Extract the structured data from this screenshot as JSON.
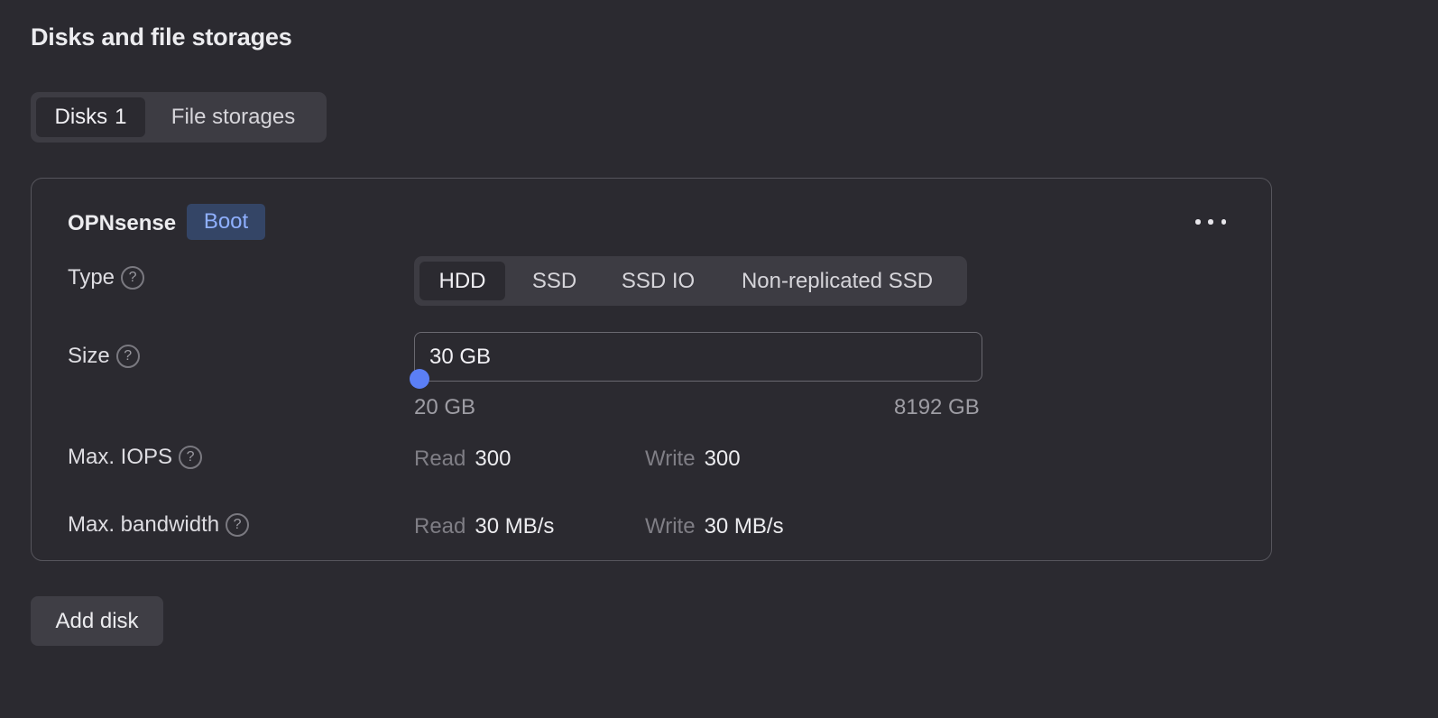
{
  "section": {
    "title": "Disks and file storages"
  },
  "tabs": [
    {
      "label": "Disks",
      "count": "1",
      "active": true
    },
    {
      "label": "File storages",
      "active": false
    }
  ],
  "disk": {
    "name": "OPNsense",
    "badge": "Boot",
    "more_icon": "more-horizontal-icon",
    "type": {
      "label": "Type",
      "help": "?",
      "options": [
        "HDD",
        "SSD",
        "SSD IO",
        "Non-replicated SSD"
      ],
      "selected": "HDD"
    },
    "size": {
      "label": "Size",
      "help": "?",
      "value": "30 GB",
      "min": "20 GB",
      "max": "8192 GB",
      "slider_fraction": 0.0012
    },
    "iops": {
      "label": "Max. IOPS",
      "help": "?",
      "read_label": "Read",
      "read_value": "300",
      "write_label": "Write",
      "write_value": "300"
    },
    "bandwidth": {
      "label": "Max. bandwidth",
      "help": "?",
      "read_label": "Read",
      "read_value": "30 MB/s",
      "write_label": "Write",
      "write_value": "30 MB/s"
    }
  },
  "actions": {
    "add_disk": "Add disk"
  },
  "colors": {
    "background": "#2b2a30",
    "accent": "#5b7ff5",
    "badge_bg": "#344566",
    "badge_text": "#8fb0ff"
  }
}
